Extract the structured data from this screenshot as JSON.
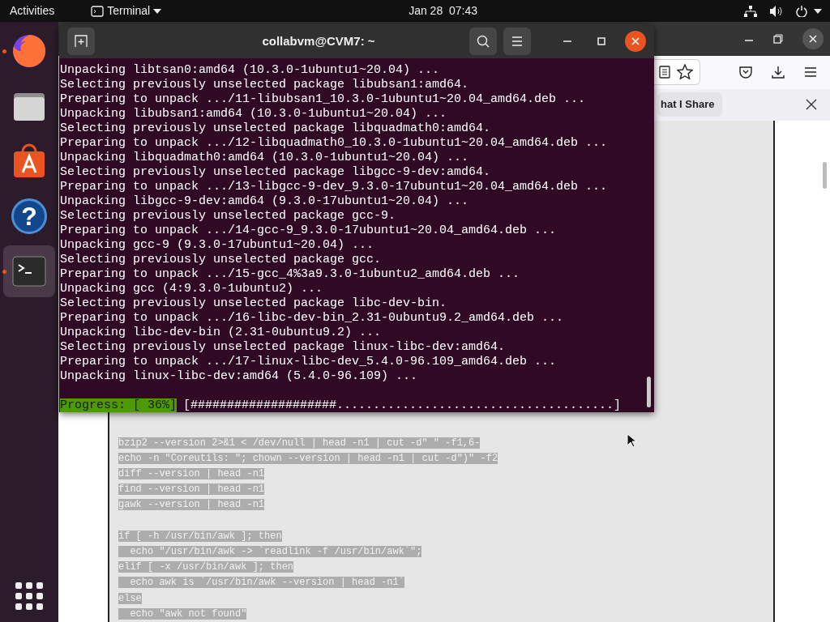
{
  "top_bar": {
    "activities": "Activities",
    "app_menu": "Terminal",
    "clock": "Jan 28  07:43"
  },
  "dock": {
    "items": [
      {
        "kind": "firefox",
        "running": true,
        "selected": false
      },
      {
        "kind": "files",
        "running": false,
        "selected": false
      },
      {
        "kind": "store",
        "running": false,
        "selected": false
      },
      {
        "kind": "help",
        "glyph": "?",
        "running": false,
        "selected": false
      },
      {
        "kind": "terminal",
        "running": true,
        "selected": true
      }
    ]
  },
  "browser": {
    "notification": "hat I Share",
    "code_blocks": [
      [
        "bzip2 --version 2>&1 < /dev/null | head -n1 | cut -d\" \" -f1,6-",
        "echo -n \"Coreutils: \"; chown --version | head -n1 | cut -d\")\" -f2",
        "diff --version | head -n1",
        "find --version | head -n1",
        "gawk --version | head -n1"
      ],
      [
        "if [ -h /usr/bin/awk ]; then",
        "  echo \"/usr/bin/awk -> `readlink -f /usr/bin/awk`\";",
        "elif [ -x /usr/bin/awk ]; then",
        "  echo awk is `/usr/bin/awk --version | head -n1`",
        "else",
        "  echo \"awk not found\""
      ]
    ]
  },
  "terminal": {
    "title": "collabvm@CVM7: ~",
    "lines": [
      "Unpacking libtsan0:amd64 (10.3.0-1ubuntu1~20.04) ...",
      "Selecting previously unselected package libubsan1:amd64.",
      "Preparing to unpack .../11-libubsan1_10.3.0-1ubuntu1~20.04_amd64.deb ...",
      "Unpacking libubsan1:amd64 (10.3.0-1ubuntu1~20.04) ...",
      "Selecting previously unselected package libquadmath0:amd64.",
      "Preparing to unpack .../12-libquadmath0_10.3.0-1ubuntu1~20.04_amd64.deb ...",
      "Unpacking libquadmath0:amd64 (10.3.0-1ubuntu1~20.04) ...",
      "Selecting previously unselected package libgcc-9-dev:amd64.",
      "Preparing to unpack .../13-libgcc-9-dev_9.3.0-17ubuntu1~20.04_amd64.deb ...",
      "Unpacking libgcc-9-dev:amd64 (9.3.0-17ubuntu1~20.04) ...",
      "Selecting previously unselected package gcc-9.",
      "Preparing to unpack .../14-gcc-9_9.3.0-17ubuntu1~20.04_amd64.deb ...",
      "Unpacking gcc-9 (9.3.0-17ubuntu1~20.04) ...",
      "Selecting previously unselected package gcc.",
      "Preparing to unpack .../15-gcc_4%3a9.3.0-1ubuntu2_amd64.deb ...",
      "Unpacking gcc (4:9.3.0-1ubuntu2) ...",
      "Selecting previously unselected package libc-dev-bin.",
      "Preparing to unpack .../16-libc-dev-bin_2.31-0ubuntu9.2_amd64.deb ...",
      "Unpacking libc-dev-bin (2.31-0ubuntu9.2) ...",
      "Selecting previously unselected package linux-libc-dev:amd64.",
      "Preparing to unpack .../17-linux-libc-dev_5.4.0-96.109_amd64.deb ...",
      "Unpacking linux-libc-dev:amd64 (5.4.0-96.109) ..."
    ],
    "progress": {
      "label": "Progress: [ 36%]",
      "bar": "[####################......................................]"
    }
  }
}
